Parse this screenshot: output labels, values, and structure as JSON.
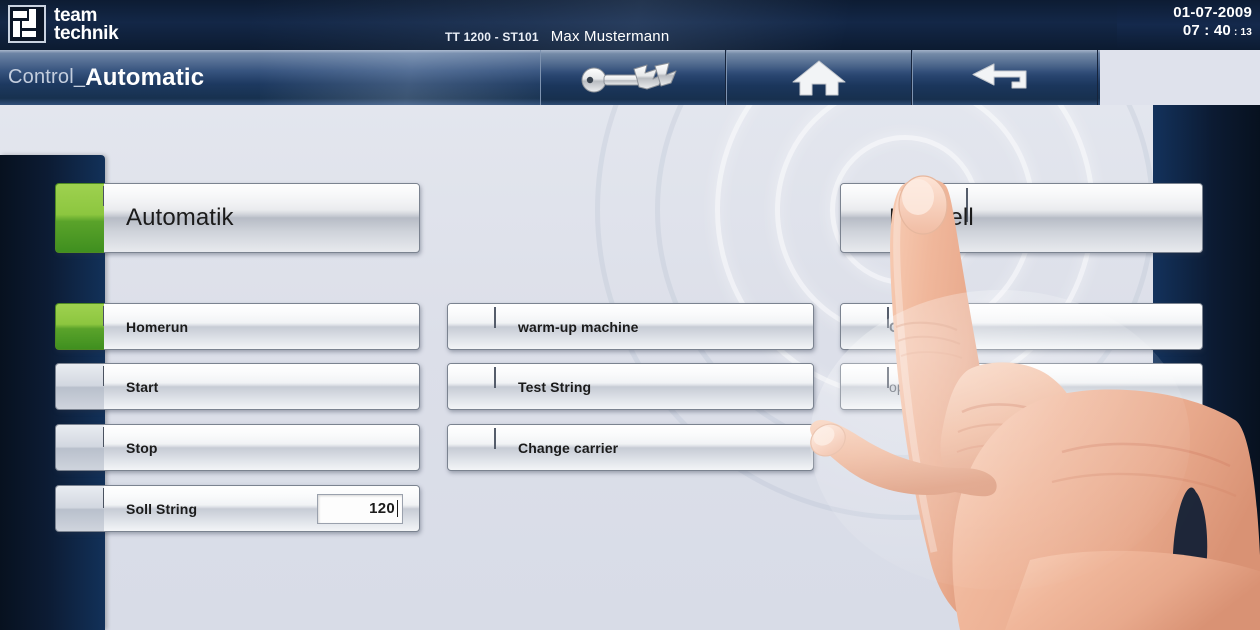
{
  "brand": {
    "line1": "team",
    "line2": "technik",
    "logo_icon": "teamtechnik-logo"
  },
  "topbar": {
    "machine_id": "TT 1200 - ST101",
    "user_name": "Max Mustermann",
    "date": "01-07-2009",
    "time_hm": "07 : 40",
    "time_sec": "13"
  },
  "navbar": {
    "title_prefix": "Control_",
    "title_main": "Automatic",
    "buttons": [
      {
        "name": "login-key-button",
        "icon": "key-icon"
      },
      {
        "name": "home-button",
        "icon": "home-icon"
      },
      {
        "name": "back-button",
        "icon": "back-arrow-icon"
      }
    ]
  },
  "columns": {
    "left": {
      "header": {
        "label": "Automatik",
        "status": "green"
      },
      "items": [
        {
          "label": "Homerun",
          "status": "green"
        },
        {
          "label": "Start",
          "status": "gray"
        },
        {
          "label": "Stop",
          "status": "gray"
        },
        {
          "label": "Soll String",
          "status": "gray",
          "field_value": "120"
        }
      ]
    },
    "middle": {
      "items": [
        {
          "label": "warm-up machine"
        },
        {
          "label": "Test String"
        },
        {
          "label": "Change carrier"
        }
      ]
    },
    "right": {
      "header": {
        "label": "Manuell"
      },
      "items": [
        {
          "label": "Co"
        },
        {
          "label": "ope               fet"
        }
      ]
    }
  },
  "colors": {
    "accent_green": "#8cc63f",
    "panel_navy": "#0c1b33",
    "nav_blue": "#1d3960",
    "content_bg": "#dfe2ec"
  }
}
